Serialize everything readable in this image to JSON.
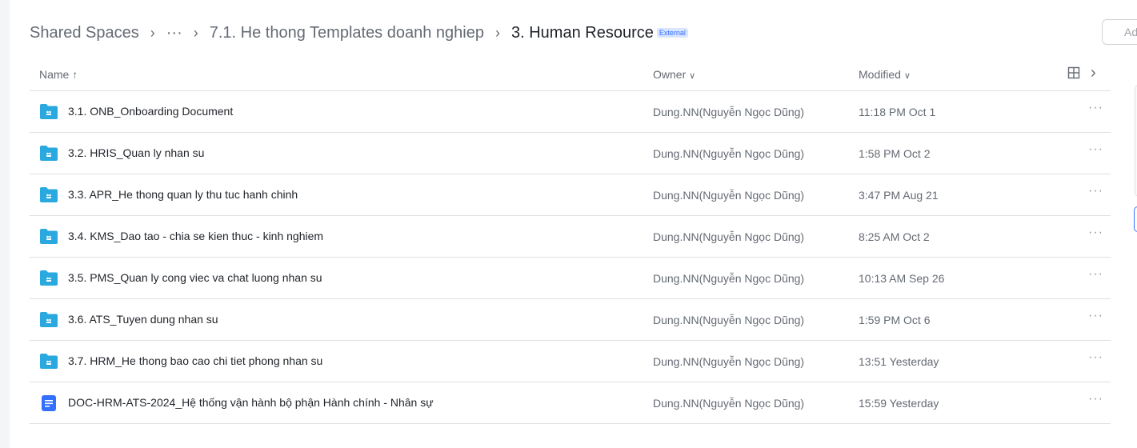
{
  "breadcrumb": {
    "items": [
      "Shared Spaces",
      "···",
      "7.1. He thong Templates doanh nghiep",
      "3. Human Resource"
    ],
    "badge": "External"
  },
  "header_button": "Ad",
  "table": {
    "columns": {
      "name": "Name ↑",
      "owner": "Owner",
      "modified": "Modified"
    },
    "rows": [
      {
        "type": "shared-folder",
        "name": "3.1. ONB_Onboarding Document",
        "owner": "Dung.NN(Nguyễn Ngọc Dũng)",
        "modified": "11:18 PM Oct 1"
      },
      {
        "type": "shared-folder",
        "name": "3.2. HRIS_Quan ly nhan su",
        "owner": "Dung.NN(Nguyễn Ngọc Dũng)",
        "modified": "1:58 PM Oct 2"
      },
      {
        "type": "shared-folder",
        "name": "3.3. APR_He thong quan ly thu tuc hanh chinh",
        "owner": "Dung.NN(Nguyễn Ngọc Dũng)",
        "modified": "3:47 PM Aug 21"
      },
      {
        "type": "shared-folder",
        "name": "3.4. KMS_Dao tao - chia se kien thuc - kinh nghiem",
        "owner": "Dung.NN(Nguyễn Ngọc Dũng)",
        "modified": "8:25 AM Oct 2"
      },
      {
        "type": "shared-folder",
        "name": "3.5. PMS_Quan ly cong viec va chat luong nhan su",
        "owner": "Dung.NN(Nguyễn Ngọc Dũng)",
        "modified": "10:13 AM Sep 26"
      },
      {
        "type": "shared-folder",
        "name": "3.6. ATS_Tuyen dung nhan su",
        "owner": "Dung.NN(Nguyễn Ngọc Dũng)",
        "modified": "1:59 PM Oct 6"
      },
      {
        "type": "shared-folder",
        "name": "3.7. HRM_He thong bao cao chi tiet phong nhan su",
        "owner": "Dung.NN(Nguyễn Ngọc Dũng)",
        "modified": "13:51 Yesterday"
      },
      {
        "type": "document",
        "name": "DOC-HRM-ATS-2024_Hệ thống vận hành bộ phận Hành chính - Nhân sự",
        "owner": "Dung.NN(Nguyễn Ngọc Dũng)",
        "modified": "15:59 Yesterday"
      }
    ]
  },
  "colors": {
    "folder": "#29a9e0",
    "doc": "#3370ff",
    "accent": "#3370ff"
  }
}
